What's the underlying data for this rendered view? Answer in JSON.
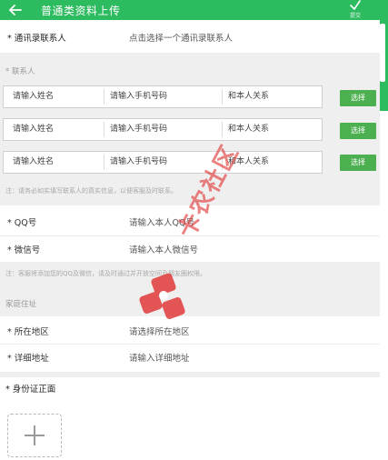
{
  "header": {
    "title": "普通类资料上传",
    "submit_label": "提交"
  },
  "contact_picker": {
    "label": "* 通讯录联系人",
    "value": "点击选择一个通讯录联系人"
  },
  "contacts_section": {
    "title": "* 联系人"
  },
  "contacts": [
    {
      "name_placeholder": "请输入姓名",
      "phone_placeholder": "请输入手机号码",
      "relation_placeholder": "和本人关系",
      "select_label": "选择"
    },
    {
      "name_placeholder": "请输入姓名",
      "phone_placeholder": "请输入手机号码",
      "relation_placeholder": "和本人关系",
      "select_label": "选择"
    },
    {
      "name_placeholder": "请输入姓名",
      "phone_placeholder": "请输入手机号码",
      "relation_placeholder": "和本人关系",
      "select_label": "选择"
    }
  ],
  "contacts_note": "注：请务必如实填写联系人的真实信息，以便客服及时联系。",
  "qq": {
    "label": "* QQ号",
    "placeholder": "请输入本人QQ号"
  },
  "wechat": {
    "label": "* 微信号",
    "placeholder": "请输入本人微信号"
  },
  "social_note": "注：客服将添加您的QQ及微信，请及时通过并开放空间及朋友圈权限。",
  "address_section": {
    "title": "家庭住址"
  },
  "region": {
    "label": "* 所在地区",
    "placeholder": "请选择所在地区"
  },
  "address": {
    "label": "* 详细地址",
    "placeholder": "请输入详细地址"
  },
  "id_card": {
    "label": "* 身份证正面"
  },
  "watermark": {
    "text": "卡农社区"
  },
  "colors": {
    "header": "#2dbb5f",
    "button": "#4caf50",
    "watermark": "#e23a3a"
  }
}
